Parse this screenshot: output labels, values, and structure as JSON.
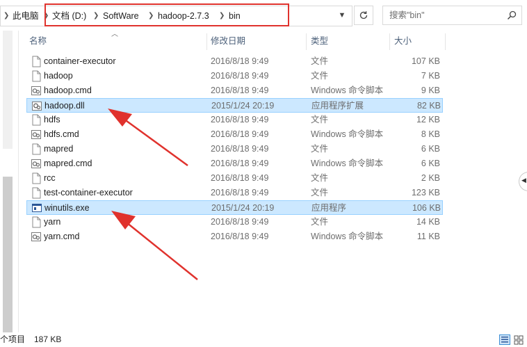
{
  "address_bar": {
    "crumbs": [
      "此电脑",
      "文档 (D:)",
      "SoftWare",
      "hadoop-2.7.3",
      "bin"
    ],
    "search_placeholder": "搜索\"bin\""
  },
  "columns": {
    "name": "名称",
    "date": "修改日期",
    "type": "类型",
    "size": "大小"
  },
  "files": [
    {
      "name": "container-executor",
      "date": "2016/8/18 9:49",
      "type": "文件",
      "size": "107 KB",
      "icon": "blank-file-icon",
      "selected": false
    },
    {
      "name": "hadoop",
      "date": "2016/8/18 9:49",
      "type": "文件",
      "size": "7 KB",
      "icon": "blank-file-icon",
      "selected": false
    },
    {
      "name": "hadoop.cmd",
      "date": "2016/8/18 9:49",
      "type": "Windows 命令脚本",
      "size": "9 KB",
      "icon": "cmd-file-icon",
      "selected": false
    },
    {
      "name": "hadoop.dll",
      "date": "2015/1/24 20:19",
      "type": "应用程序扩展",
      "size": "82 KB",
      "icon": "dll-file-icon",
      "selected": true
    },
    {
      "name": "hdfs",
      "date": "2016/8/18 9:49",
      "type": "文件",
      "size": "12 KB",
      "icon": "blank-file-icon",
      "selected": false
    },
    {
      "name": "hdfs.cmd",
      "date": "2016/8/18 9:49",
      "type": "Windows 命令脚本",
      "size": "8 KB",
      "icon": "cmd-file-icon",
      "selected": false
    },
    {
      "name": "mapred",
      "date": "2016/8/18 9:49",
      "type": "文件",
      "size": "6 KB",
      "icon": "blank-file-icon",
      "selected": false
    },
    {
      "name": "mapred.cmd",
      "date": "2016/8/18 9:49",
      "type": "Windows 命令脚本",
      "size": "6 KB",
      "icon": "cmd-file-icon",
      "selected": false
    },
    {
      "name": "rcc",
      "date": "2016/8/18 9:49",
      "type": "文件",
      "size": "2 KB",
      "icon": "blank-file-icon",
      "selected": false
    },
    {
      "name": "test-container-executor",
      "date": "2016/8/18 9:49",
      "type": "文件",
      "size": "123 KB",
      "icon": "blank-file-icon",
      "selected": false
    },
    {
      "name": "winutils.exe",
      "date": "2015/1/24 20:19",
      "type": "应用程序",
      "size": "106 KB",
      "icon": "exe-file-icon",
      "selected": true
    },
    {
      "name": "yarn",
      "date": "2016/8/18 9:49",
      "type": "文件",
      "size": "14 KB",
      "icon": "blank-file-icon",
      "selected": false
    },
    {
      "name": "yarn.cmd",
      "date": "2016/8/18 9:49",
      "type": "Windows 命令脚本",
      "size": "11 KB",
      "icon": "cmd-file-icon",
      "selected": false
    }
  ],
  "status_bar": {
    "item_count": "个项目",
    "selected_size": "187 KB"
  },
  "colors": {
    "selection_bg": "#cce8ff",
    "selection_border": "#99d1ff",
    "annotation_red": "#e0322d",
    "header_text": "#4c607a"
  }
}
